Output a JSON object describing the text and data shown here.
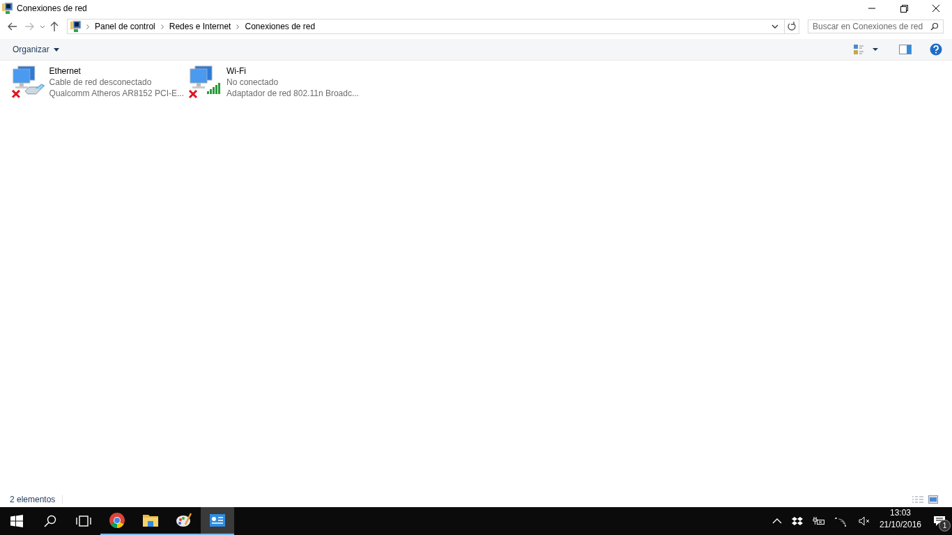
{
  "window": {
    "title": "Conexiones de red"
  },
  "address_bar": {
    "breadcrumbs": [
      "Panel de control",
      "Redes e Internet",
      "Conexiones de red"
    ]
  },
  "search": {
    "placeholder": "Buscar en Conexiones de red"
  },
  "command_bar": {
    "organize": "Organizar"
  },
  "connections": [
    {
      "kind": "ethernet",
      "name": "Ethernet",
      "status": "Cable de red desconectado",
      "adapter": "Qualcomm Atheros AR8152 PCI-E...",
      "connected": false
    },
    {
      "kind": "wifi",
      "name": "Wi-Fi",
      "status": "No conectado",
      "adapter": "Adaptador de red 802.11n Broadc...",
      "connected": false
    }
  ],
  "status_bar": {
    "count": "2 elementos"
  },
  "taskbar": {
    "apps": [
      {
        "kind": "chrome",
        "selected": false
      },
      {
        "kind": "explorer",
        "selected": false
      },
      {
        "kind": "paint",
        "selected": false
      },
      {
        "kind": "control-panel",
        "selected": true
      }
    ],
    "time": "13:03",
    "date": "21/10/2016",
    "notifications": "1"
  }
}
